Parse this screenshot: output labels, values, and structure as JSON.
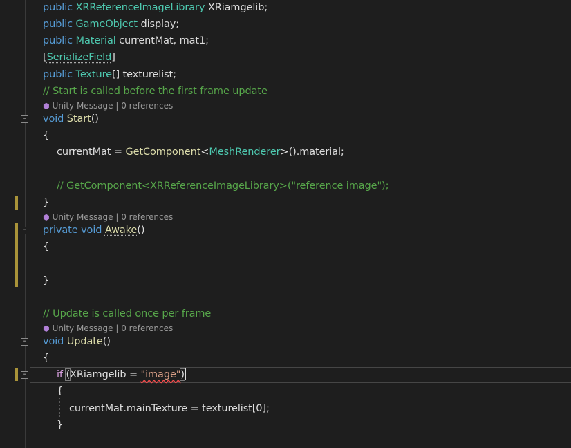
{
  "code": {
    "l1": {
      "kw": "public ",
      "ty": "XRReferenceImageLibrary",
      "rest": " XRiamgelib;"
    },
    "l2": {
      "kw": "public ",
      "ty": "GameObject",
      "rest": " display;"
    },
    "l3": {
      "kw": "public ",
      "ty": "Material",
      "rest": " currentMat, mat1;"
    },
    "l4": {
      "open": "[",
      "ty": "SerializeField",
      "close": "]"
    },
    "l5": {
      "kw": "public ",
      "ty": "Texture",
      "rest": "[] texturelist;"
    },
    "l6": {
      "cm": "// Start is called before the first frame update"
    },
    "l7": {
      "kw": "void ",
      "fn": "Start",
      "rest": "()"
    },
    "l8": {
      "text": "{"
    },
    "l9": {
      "pre": "currentMat = ",
      "fn": "GetComponent",
      "lt": "<",
      "ty": "MeshRenderer",
      "rest": ">().material;"
    },
    "l10": {
      "cm": "// GetComponent<XRReferenceImageLibrary>(\"reference image\");"
    },
    "l11": {
      "text": "}"
    },
    "l12": {
      "kw": "private void ",
      "fn": "Awake",
      "rest": "()"
    },
    "l13": {
      "text": "{"
    },
    "l14": {
      "text": "}"
    },
    "l15": {
      "cm": "// Update is called once per frame"
    },
    "l16": {
      "kw": "void ",
      "fn": "Update",
      "rest": "()"
    },
    "l17": {
      "text": "{"
    },
    "l18": {
      "ctl": "if ",
      "open": "(",
      "pre": "XRiamgelib = ",
      "str": "\"image\"",
      "close": ")"
    },
    "l19": {
      "text": "{"
    },
    "l20": {
      "text": "currentMat.mainTexture = texturelist[0];"
    },
    "l21": {
      "text": "}"
    }
  },
  "codelens": {
    "text": "Unity Message | 0 references",
    "icon": "unity-cube-icon"
  },
  "colors": {
    "background": "#1e1e1e",
    "keyword": "#569cd6",
    "type": "#4ec9b0",
    "method": "#dcdcaa",
    "comment": "#57a64a",
    "string": "#d69d85",
    "control": "#d8a0df",
    "changed_marker": "#c2a83e"
  }
}
